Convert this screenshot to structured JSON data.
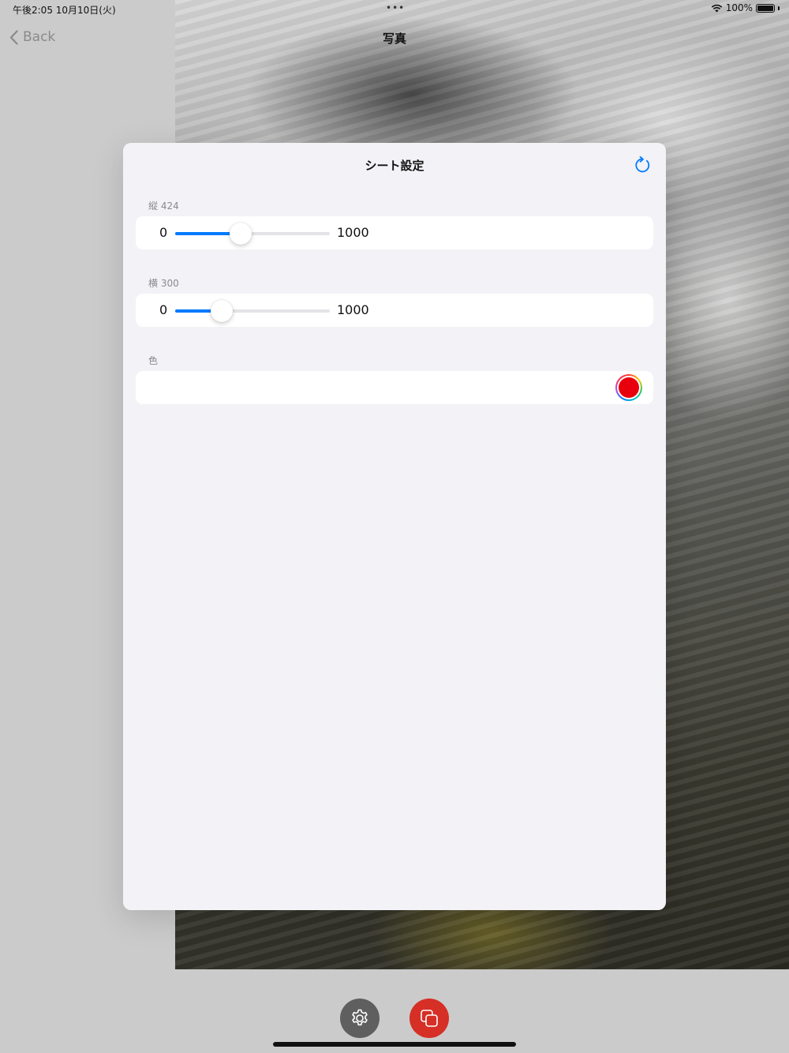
{
  "status_bar": {
    "time": "午後2:05   10月10日(火)",
    "dots": "•••",
    "battery_percent": "100%"
  },
  "nav": {
    "back_label": "Back",
    "title": "写真"
  },
  "sheet": {
    "title": "シート設定",
    "height": {
      "label": "縦 424",
      "min_label": "0",
      "max_label": "1000",
      "value": 424,
      "min": 0,
      "max": 1000
    },
    "width": {
      "label": "横 300",
      "min_label": "0",
      "max_label": "1000",
      "value": 300,
      "min": 0,
      "max": 1000
    },
    "color": {
      "label": "色",
      "selected_color": "#e8000d"
    }
  },
  "toolbar": {
    "settings_icon": "gear-icon",
    "copy_icon": "copy-icon",
    "settings_color": "#5f5f5f",
    "copy_color": "#d62f25"
  },
  "colors": {
    "accent": "#007aff",
    "sheet_bg": "#f2f2f7"
  }
}
